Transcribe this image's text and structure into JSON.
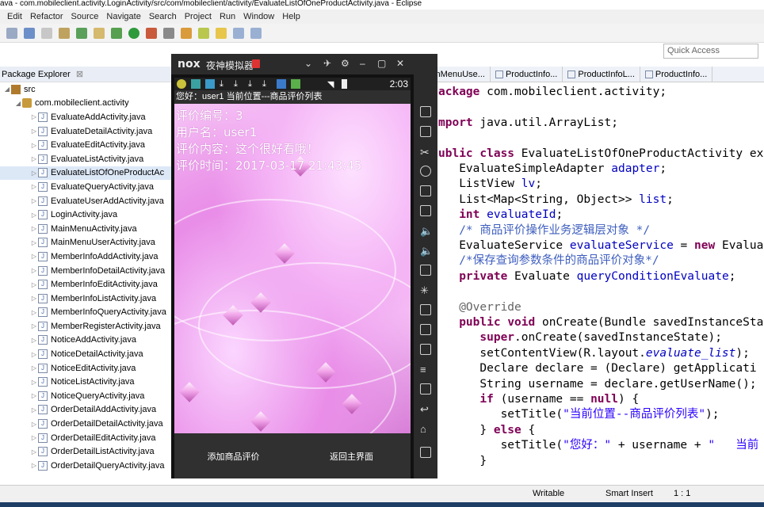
{
  "window": {
    "title": "ava - com.mobileclient.activity.LoginActivity/src/com/mobileclient/activity/EvaluateListOfOneProductActivity.java - Eclipse"
  },
  "menu": [
    "Edit",
    "Refactor",
    "Source",
    "Navigate",
    "Search",
    "Project",
    "Run",
    "Window",
    "Help"
  ],
  "quick_access": {
    "placeholder": "Quick Access"
  },
  "package_explorer": {
    "title": "Package Explorer",
    "src": "src",
    "package": "com.mobileclient.activity",
    "files": [
      "EvaluateAddActivity.java",
      "EvaluateDetailActivity.java",
      "EvaluateEditActivity.java",
      "EvaluateListActivity.java",
      "EvaluateListOfOneProductAc",
      "EvaluateQueryActivity.java",
      "EvaluateUserAddActivity.java",
      "LoginActivity.java",
      "MainMenuActivity.java",
      "MainMenuUserActivity.java",
      "MemberInfoAddActivity.java",
      "MemberInfoDetailActivity.java",
      "MemberInfoEditActivity.java",
      "MemberInfoListActivity.java",
      "MemberInfoQueryActivity.java",
      "MemberRegisterActivity.java",
      "NoticeAddActivity.java",
      "NoticeDetailActivity.java",
      "NoticeEditActivity.java",
      "NoticeListActivity.java",
      "NoticeQueryActivity.java",
      "OrderDetailAddActivity.java",
      "OrderDetailDetailActivity.java",
      "OrderDetailEditActivity.java",
      "OrderDetailListActivity.java",
      "OrderDetailQueryActivity.java"
    ],
    "selected_index": 4
  },
  "editor_tabs": [
    "ainMenuUse...",
    "ProductInfo...",
    "ProductInfoL...",
    "ProductInfo..."
  ],
  "code_lines": [
    "ackage com.mobileclient.activity;",
    "",
    "mport java.util.ArrayList;",
    "",
    "ublic class EvaluateListOfOneProductActivity ex",
    "   EvaluateSimpleAdapter adapter;",
    "   ListView lv;",
    "   List<Map<String, Object>> list;",
    "   int evaluateId;",
    "   /* 商品评价操作业务逻辑层对象 */",
    "   EvaluateService evaluateService = new Evalua",
    "   /*保存查询参数条件的商品评价对象*/",
    "   private Evaluate queryConditionEvaluate;",
    "",
    "   @Override",
    "   public void onCreate(Bundle savedInstanceSta",
    "      super.onCreate(savedInstanceState);",
    "      setContentView(R.layout.evaluate_list);",
    "      Declare declare = (Declare) getApplicati",
    "      String username = declare.getUserName();",
    "      if (username == null) {",
    "         setTitle(\"当前位置--商品评价列表\");",
    "      } else {",
    "         setTitle(\"您好：\" + username + \"   当前",
    "      }"
  ],
  "status": {
    "writable": "Writable",
    "insert": "Smart Insert",
    "position": "1 : 1"
  },
  "emulator": {
    "logo": "nox",
    "name": "夜神模拟器",
    "clock": "2:03",
    "app_title": "您好：user1  当前位置---商品评价列表",
    "lines": [
      "评价编号：3",
      "用户名：user1",
      "评价内容：这个很好看哦！",
      "评价时间：2017-03-17 21:43:45"
    ],
    "buttons": {
      "add": "添加商品评价",
      "back": "返回主界面"
    }
  },
  "colors": {
    "keyword": "#7f0055",
    "field": "#0000c0",
    "comment": "#3f5fbf",
    "string": "#2a00ff"
  }
}
